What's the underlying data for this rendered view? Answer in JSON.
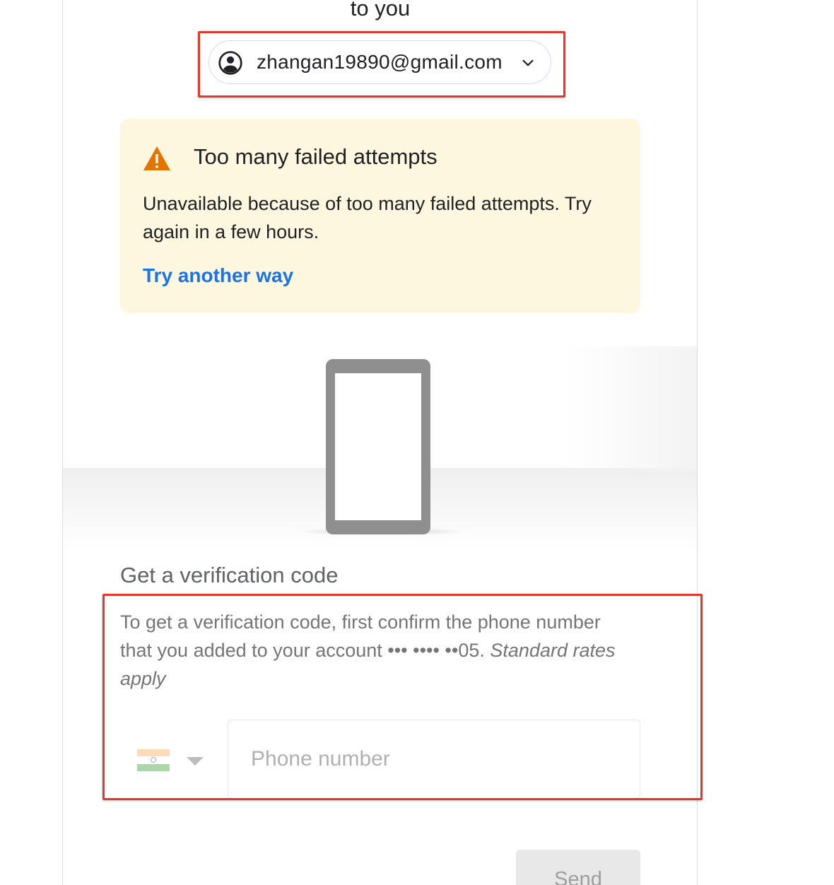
{
  "header": {
    "heading_tail": "to you"
  },
  "account": {
    "email": "zhangan19890@gmail.com",
    "avatar_icon": "account-circle-icon",
    "expand_icon": "chevron-down-icon"
  },
  "alert": {
    "icon": "warning-icon",
    "title": "Too many failed attempts",
    "body": "Unavailable because of too many failed attempts. Try again in a few hours.",
    "link_label": "Try another way",
    "background_color": "#fef7e0",
    "warning_color": "#e37400",
    "link_color": "#1a73e8"
  },
  "illustration": {
    "icon": "phone-illustration"
  },
  "verification": {
    "title": "Get a verification code",
    "description_plain": "To get a verification code, first confirm the phone number that you added to your account ••• •••• ••05. ",
    "description_italic": "Standard rates apply",
    "country_flag": "india-flag-icon",
    "phone_placeholder": "Phone number",
    "phone_value": "",
    "send_label": "Send"
  },
  "annotations": {
    "highlight_color": "#e03a2f"
  }
}
